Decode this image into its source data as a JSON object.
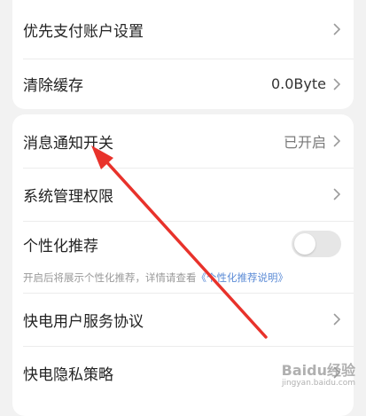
{
  "settings_top": {
    "items": [
      {
        "label": "优先支付账户设置",
        "value": ""
      },
      {
        "label": "清除缓存",
        "value": "0.0Byte"
      }
    ]
  },
  "settings_bottom": {
    "notification": {
      "label": "消息通知开关",
      "value": "已开启"
    },
    "permissions": {
      "label": "系统管理权限"
    },
    "personalized": {
      "label": "个性化推荐",
      "enabled": false,
      "hint_text": "开启后将展示个性化推荐，详情请查看",
      "hint_link": "《个性化推荐说明》"
    },
    "service_agreement": {
      "label": "快电用户服务协议"
    },
    "privacy_policy": {
      "label": "快电隐私策略"
    }
  },
  "colors": {
    "annotation_arrow": "#e8322b",
    "link": "#5b8bd6",
    "toggle_off": "#e6e6e6"
  },
  "watermark": {
    "title": "Baidu经验",
    "subtitle": "jingyan.baidu.com"
  }
}
